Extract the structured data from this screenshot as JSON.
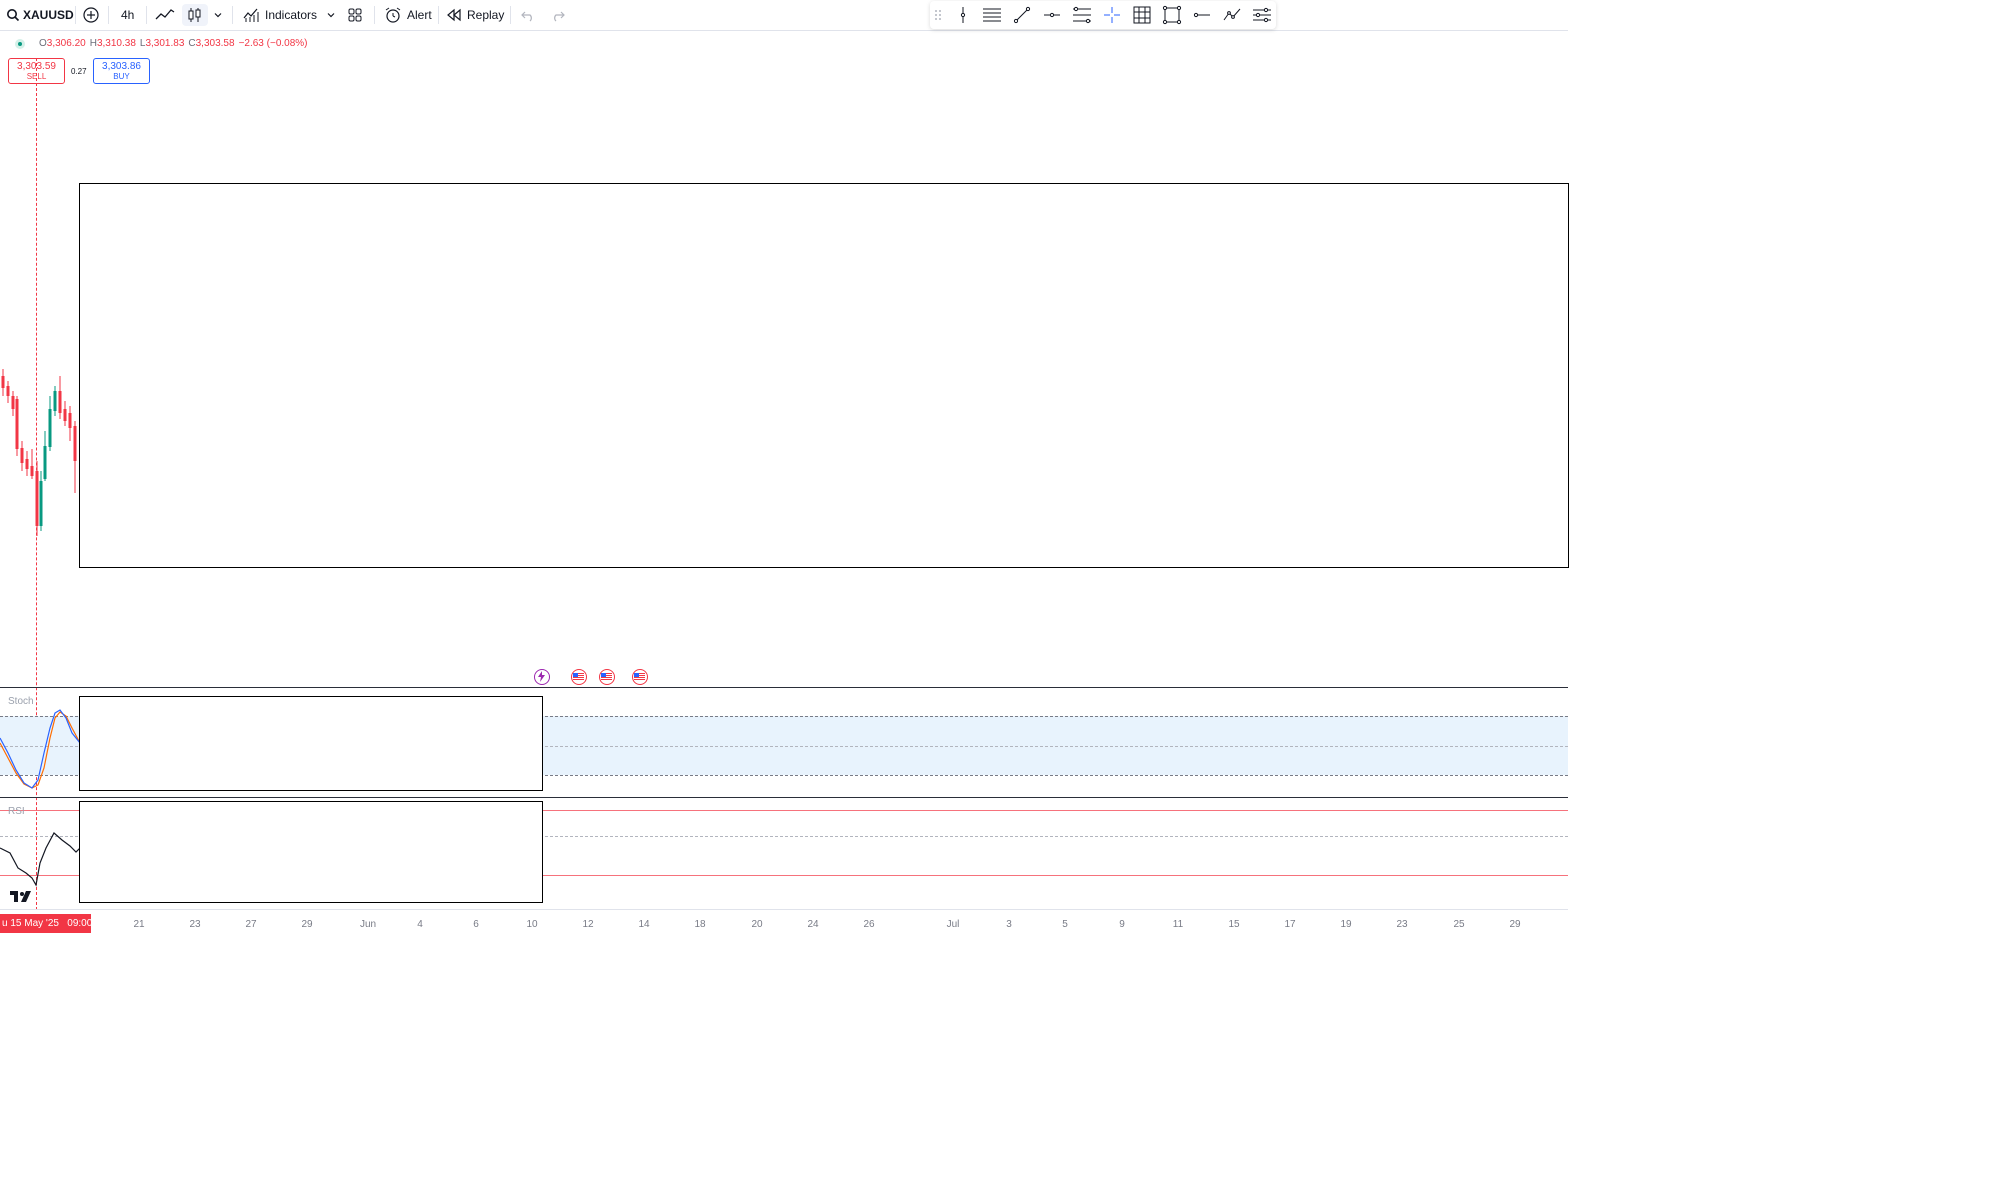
{
  "toolbar": {
    "symbol": "XAUUSD",
    "interval": "4h",
    "indicators_label": "Indicators",
    "alert_label": "Alert",
    "replay_label": "Replay"
  },
  "legend": {
    "open_key": "O",
    "open": "3,306.20",
    "high_key": "H",
    "high": "3,310.38",
    "low_key": "L",
    "low": "3,301.83",
    "close_key": "C",
    "close": "3,303.58",
    "change": "−2.63 (−0.08%)"
  },
  "trade": {
    "sell_price": "3,303.59",
    "sell_label": "SELL",
    "spread": "0.27",
    "buy_price": "3,303.86",
    "buy_label": "BUY"
  },
  "panes": {
    "stoch_title": "Stoch",
    "rsi_title": "RSI"
  },
  "time_axis": {
    "cursor_label": "u 15 May '25   09:00",
    "labels": [
      "21",
      "23",
      "27",
      "29",
      "Jun",
      "4",
      "6",
      "10",
      "12",
      "14",
      "18",
      "20",
      "24",
      "26",
      "Jul",
      "3",
      "5",
      "9",
      "11",
      "15",
      "17",
      "19",
      "23",
      "25",
      "29"
    ]
  },
  "colors": {
    "up": "#089981",
    "down": "#f23645",
    "accent": "#2962ff",
    "stoch_k": "#2962ff",
    "stoch_d": "#ff6d00",
    "band_fill": "#e8f3fd"
  },
  "icons": {
    "event_types": [
      "lightning-icon",
      "us-flag-icon",
      "us-flag-icon",
      "us-flag-icon"
    ]
  }
}
